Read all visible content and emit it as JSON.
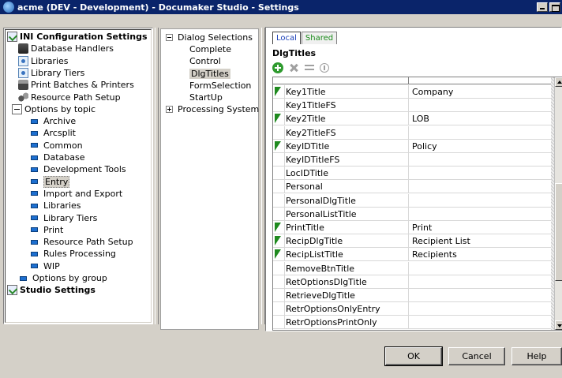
{
  "window": {
    "title": "acme (DEV - Development) - Documaker Studio - Settings"
  },
  "left_tree": {
    "root_label": "INI Configuration Settings",
    "items": [
      {
        "label": "Database Handlers",
        "icon": "database-icon"
      },
      {
        "label": "Libraries",
        "icon": "library-icon"
      },
      {
        "label": "Library Tiers",
        "icon": "library-icon"
      },
      {
        "label": "Print Batches & Printers",
        "icon": "printer-icon"
      },
      {
        "label": "Resource Path Setup",
        "icon": "path-icon"
      },
      {
        "label": "Options by topic",
        "icon": "options-icon"
      }
    ],
    "topics": [
      "Archive",
      "Arcsplit",
      "Common",
      "Database",
      "Development Tools",
      "Entry",
      "Import and Export",
      "Libraries",
      "Library Tiers",
      "Print",
      "Resource Path Setup",
      "Rules Processing",
      "WIP"
    ],
    "selected_topic": "Entry",
    "options_by_group": "Options by group",
    "studio_settings": "Studio Settings"
  },
  "middle_tree": {
    "group1": "Dialog Selections",
    "group1_items": [
      "Complete",
      "Control",
      "DlgTitles",
      "FormSelection",
      "StartUp"
    ],
    "selected": "DlgTitles",
    "group2": "Processing System"
  },
  "right": {
    "tab_local": "Local",
    "tab_shared": "Shared",
    "section_title": "DlgTitles",
    "rows": [
      {
        "name": "Key1Title",
        "value": "Company",
        "marked": true
      },
      {
        "name": "Key1TitleFS",
        "value": "",
        "marked": false
      },
      {
        "name": "Key2Title",
        "value": "LOB",
        "marked": true
      },
      {
        "name": "Key2TitleFS",
        "value": "",
        "marked": false
      },
      {
        "name": "KeyIDTitle",
        "value": "Policy",
        "marked": true
      },
      {
        "name": "KeyIDTitleFS",
        "value": "",
        "marked": false
      },
      {
        "name": "LocIDTitle",
        "value": "",
        "marked": false
      },
      {
        "name": "Personal",
        "value": "",
        "marked": false
      },
      {
        "name": "PersonalDlgTitle",
        "value": "",
        "marked": false
      },
      {
        "name": "PersonalListTitle",
        "value": "",
        "marked": false
      },
      {
        "name": "PrintTitle",
        "value": "Print",
        "marked": true
      },
      {
        "name": "RecipDlgTitle",
        "value": "Recipient List",
        "marked": true
      },
      {
        "name": "RecipListTitle",
        "value": "Recipients",
        "marked": true
      },
      {
        "name": "RemoveBtnTitle",
        "value": "",
        "marked": false
      },
      {
        "name": "RetOptionsDlgTitle",
        "value": "",
        "marked": false
      },
      {
        "name": "RetrieveDlgTitle",
        "value": "",
        "marked": false
      },
      {
        "name": "RetrOptionsOnlyEntry",
        "value": "",
        "marked": false
      },
      {
        "name": "RetrOptionsPrintOnly",
        "value": "",
        "marked": false
      }
    ]
  },
  "buttons": {
    "ok": "OK",
    "cancel": "Cancel",
    "help": "Help"
  }
}
